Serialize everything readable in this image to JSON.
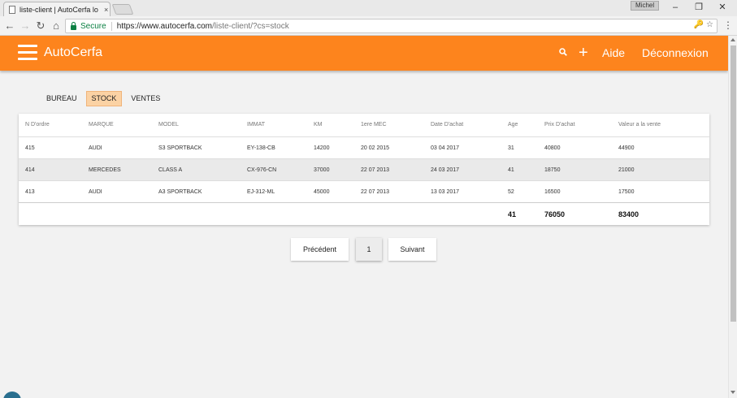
{
  "browser": {
    "tab_title": "liste-client | AutoCerfa lo",
    "tab_close": "×",
    "user": "Michel",
    "window_controls": {
      "minimize": "–",
      "restore": "❐",
      "close": "✕"
    },
    "nav": {
      "back": "←",
      "forward": "→",
      "reload": "↻",
      "home": "⌂"
    },
    "secure_label": "Secure",
    "url_host": "https://www.autocerfa.com",
    "url_path": "/liste-client/?cs=stock",
    "omni_icons": "🔑 ☆",
    "menu": "⋮"
  },
  "header": {
    "brand": "AutoCerfa",
    "plus": "+",
    "help": "Aide",
    "logout": "Déconnexion"
  },
  "view_tabs": [
    {
      "label": "BUREAU"
    },
    {
      "label": "STOCK",
      "active": true
    },
    {
      "label": "VENTES"
    }
  ],
  "table": {
    "columns": [
      "N D'ordre",
      "MARQUE",
      "MODEL",
      "IMMAT",
      "KM",
      "1ere MEC",
      "Date D'achat",
      "Age",
      "Prix D'achat",
      "Valeur a la vente"
    ],
    "rows": [
      [
        "415",
        "AUDI",
        "S3 SPORTBACK",
        "EY-138-CB",
        "14200",
        "20 02 2015",
        "03 04 2017",
        "31",
        "40800",
        "44900"
      ],
      [
        "414",
        "MERCEDES",
        "CLASS A",
        "CX-976-CN",
        "37000",
        "22 07 2013",
        "24 03 2017",
        "41",
        "18750",
        "21000"
      ],
      [
        "413",
        "AUDI",
        "A3 SPORTBACK",
        "EJ-312-ML",
        "45000",
        "22 07 2013",
        "13 03 2017",
        "52",
        "16500",
        "17500"
      ]
    ],
    "totals": {
      "age": "41",
      "purchase": "76050",
      "sale": "83400"
    }
  },
  "pagination": {
    "previous": "Précédent",
    "current_page": "1",
    "next": "Suivant"
  },
  "colors": {
    "brand_orange": "#fd841d",
    "active_tab": "#fbd2a4",
    "secure_green": "#0b8043"
  }
}
